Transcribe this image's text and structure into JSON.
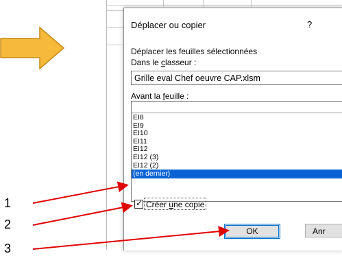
{
  "dialog": {
    "title": "Déplacer ou copier",
    "help": "?",
    "move_label": "Déplacer les feuilles sélectionnées",
    "workbook_label_pre": "Dans le ",
    "workbook_label_u": "c",
    "workbook_label_post": "lasseur :",
    "workbook_value": "Grille eval Chef oeuvre CAP.xlsm",
    "before_label_pre": "Avant la ",
    "before_label_u": "f",
    "before_label_post": "euille :",
    "sheets": [
      "EI8",
      "EI9",
      "EI10",
      "EI11",
      "EI12",
      "EI12 (3)",
      "EI12 (2)",
      "(en dernier)"
    ],
    "selected_sheet": "(en dernier)",
    "copy_label_pre": "Créer ",
    "copy_label_u": "u",
    "copy_label_post": "ne copie",
    "copy_checked": true,
    "ok_label": "OK",
    "cancel_label": "Anr"
  },
  "callouts": [
    "1",
    "2",
    "3"
  ],
  "colors": {
    "arrow_fill": "#f5b93c",
    "arrow_stroke": "#c58a14",
    "pointer_red": "#e00000",
    "selection_blue": "#0a63d4",
    "focus_blue": "#0078d7"
  }
}
